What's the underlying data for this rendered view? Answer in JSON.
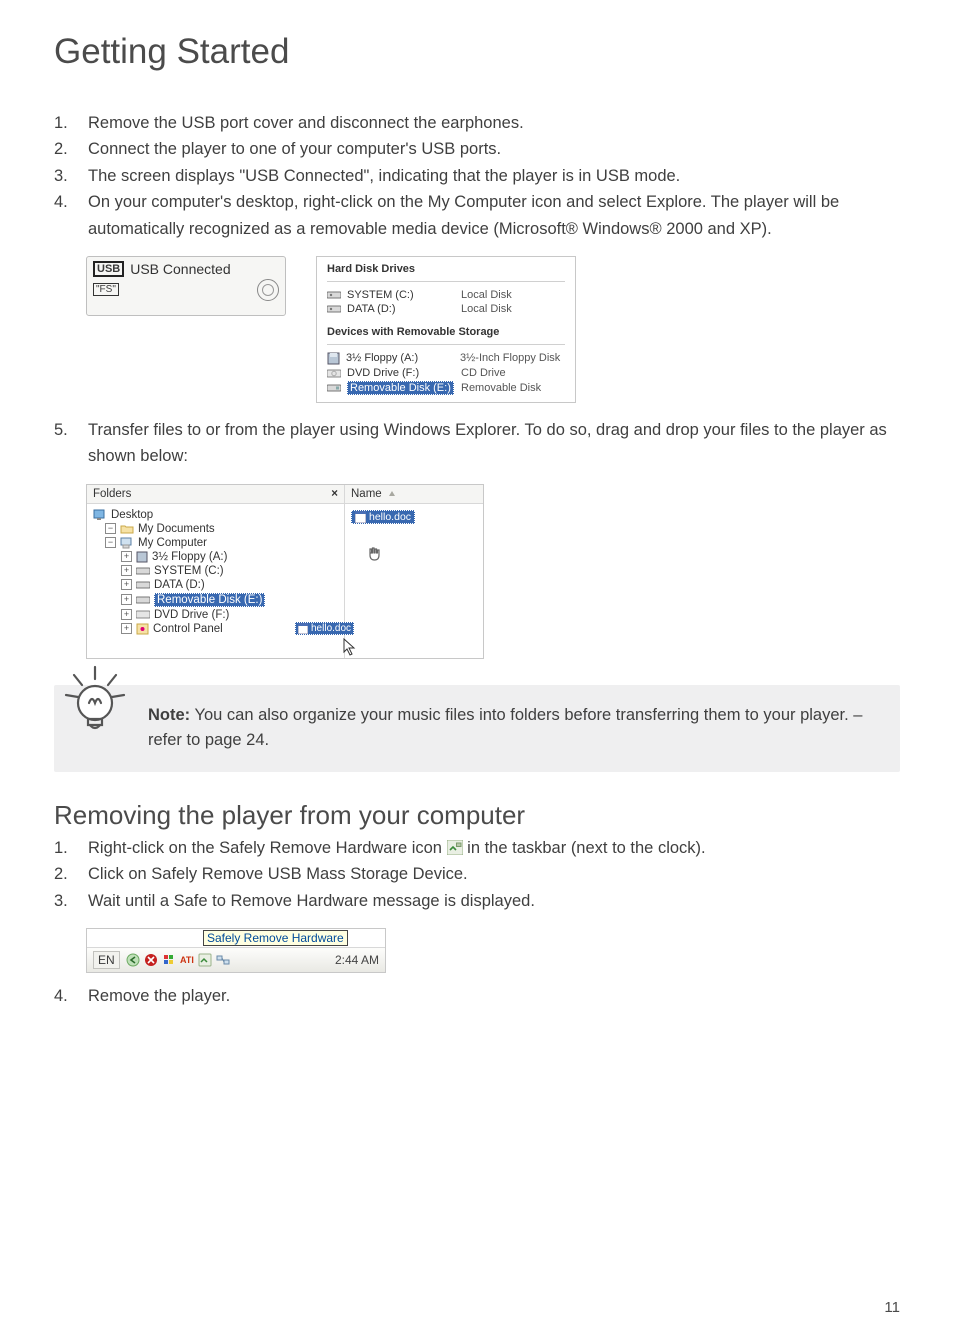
{
  "page": {
    "title": "Getting Started",
    "number": "11"
  },
  "steps1": [
    {
      "n": "1.",
      "t": "Remove the USB port cover and disconnect the earphones."
    },
    {
      "n": "2.",
      "t": "Connect the player to one of your computer's USB ports."
    },
    {
      "n": "3.",
      "t": "The screen displays \"USB Connected\", indicating that the player is in USB mode."
    },
    {
      "n": "4.",
      "t": "On your computer's desktop, right-click on the My Computer icon and select Explore. The player will be automatically recognized as a removable media device (Microsoft® Windows® 2000 and XP)."
    }
  ],
  "lcd": {
    "usb_box": "USB",
    "label": "USB Connected",
    "fs": "\"FS\""
  },
  "drives": {
    "head1": "Hard Disk Drives",
    "head2": "Devices with Removable Storage",
    "hdd": [
      {
        "label": "SYSTEM (C:)",
        "type": "Local Disk"
      },
      {
        "label": "DATA (D:)",
        "type": "Local Disk"
      }
    ],
    "rmv": [
      {
        "label": "3½ Floppy (A:)",
        "type": "3½-Inch Floppy Disk"
      },
      {
        "label": "DVD Drive (F:)",
        "type": "CD Drive"
      },
      {
        "label": "Removable Disk (E:)",
        "type": "Removable Disk",
        "selected": true
      }
    ]
  },
  "step5": {
    "n": "5.",
    "t": "Transfer files to or from the player using Windows Explorer. To do so, drag and drop your files to the player as shown below:"
  },
  "explorer": {
    "folders_label": "Folders",
    "name_label": "Name",
    "tree": [
      {
        "indent": 0,
        "pm": "",
        "label": "Desktop"
      },
      {
        "indent": 0,
        "pm": "−",
        "label": "My Documents"
      },
      {
        "indent": 0,
        "pm": "−",
        "label": "My Computer"
      },
      {
        "indent": 1,
        "pm": "+",
        "label": "3½ Floppy (A:)"
      },
      {
        "indent": 1,
        "pm": "+",
        "label": "SYSTEM (C:)"
      },
      {
        "indent": 1,
        "pm": "+",
        "label": "DATA (D:)"
      },
      {
        "indent": 1,
        "pm": "+",
        "label": "Removable Disk (E:)",
        "selected": true
      },
      {
        "indent": 1,
        "pm": "+",
        "label": "DVD Drive (F:)"
      },
      {
        "indent": 1,
        "pm": "+",
        "label": "Control Panel"
      }
    ],
    "drag_file": "hello.doc",
    "file": "hello.doc"
  },
  "note": {
    "label": "Note:",
    "text": "  You can also organize your music files into folders before transferring them to your player. – refer to page 24."
  },
  "section2": {
    "title": "Removing the player from your computer"
  },
  "steps2a": [
    {
      "n": "1.",
      "t_before": "Right-click on the Safely Remove Hardware icon ",
      "t_after": " in the taskbar (next to the clock)."
    },
    {
      "n": "2.",
      "t": "Click on Safely Remove USB Mass Storage Device."
    },
    {
      "n": "3.",
      "t": "Wait until a Safe to Remove Hardware message is displayed."
    }
  ],
  "taskbar": {
    "tooltip": "Safely Remove Hardware",
    "lang": "EN",
    "clock": "2:44 AM"
  },
  "steps2b": [
    {
      "n": "4.",
      "t": "Remove the player."
    }
  ]
}
